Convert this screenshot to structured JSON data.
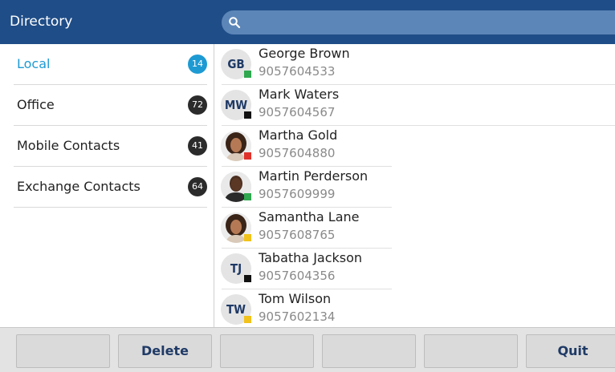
{
  "header": {
    "title": "Directory",
    "search": {
      "value": "",
      "placeholder": ""
    }
  },
  "categories": [
    {
      "label": "Local",
      "count": "14",
      "active": true
    },
    {
      "label": "Office",
      "count": "72",
      "active": false
    },
    {
      "label": "Mobile Contacts",
      "count": "41",
      "active": false
    },
    {
      "label": "Exchange Contacts",
      "count": "64",
      "active": false
    }
  ],
  "contacts": [
    {
      "name": "George Brown",
      "number": "9057604533",
      "initials": "GB",
      "avatar": "initials",
      "presence_color": "#2fa84f"
    },
    {
      "name": "Mark Waters",
      "number": "9057604567",
      "initials": "MW",
      "avatar": "initials",
      "presence_color": "#111111"
    },
    {
      "name": "Martha Gold",
      "number": "9057604880",
      "initials": "",
      "avatar": "photo-woman",
      "presence_color": "#e0322b"
    },
    {
      "name": "Martin Perderson",
      "number": "9057609999",
      "initials": "",
      "avatar": "photo-man",
      "presence_color": "#2fa84f"
    },
    {
      "name": "Samantha Lane",
      "number": "9057608765",
      "initials": "",
      "avatar": "photo-woman",
      "presence_color": "#f2c21a"
    },
    {
      "name": "Tabatha Jackson",
      "number": "9057604356",
      "initials": "TJ",
      "avatar": "initials",
      "presence_color": "#111111"
    },
    {
      "name": "Tom Wilson",
      "number": "9057602134",
      "initials": "TW",
      "avatar": "initials",
      "presence_color": "#f2c21a"
    }
  ],
  "softkeys": [
    "",
    "Delete",
    "",
    "",
    "",
    "Quit"
  ],
  "colors": {
    "header_bg": "#1f4d87",
    "search_bg": "#5d86b8",
    "accent": "#1e9ad3",
    "badge": "#2b2b2b",
    "softkey_text": "#1f3a66"
  }
}
